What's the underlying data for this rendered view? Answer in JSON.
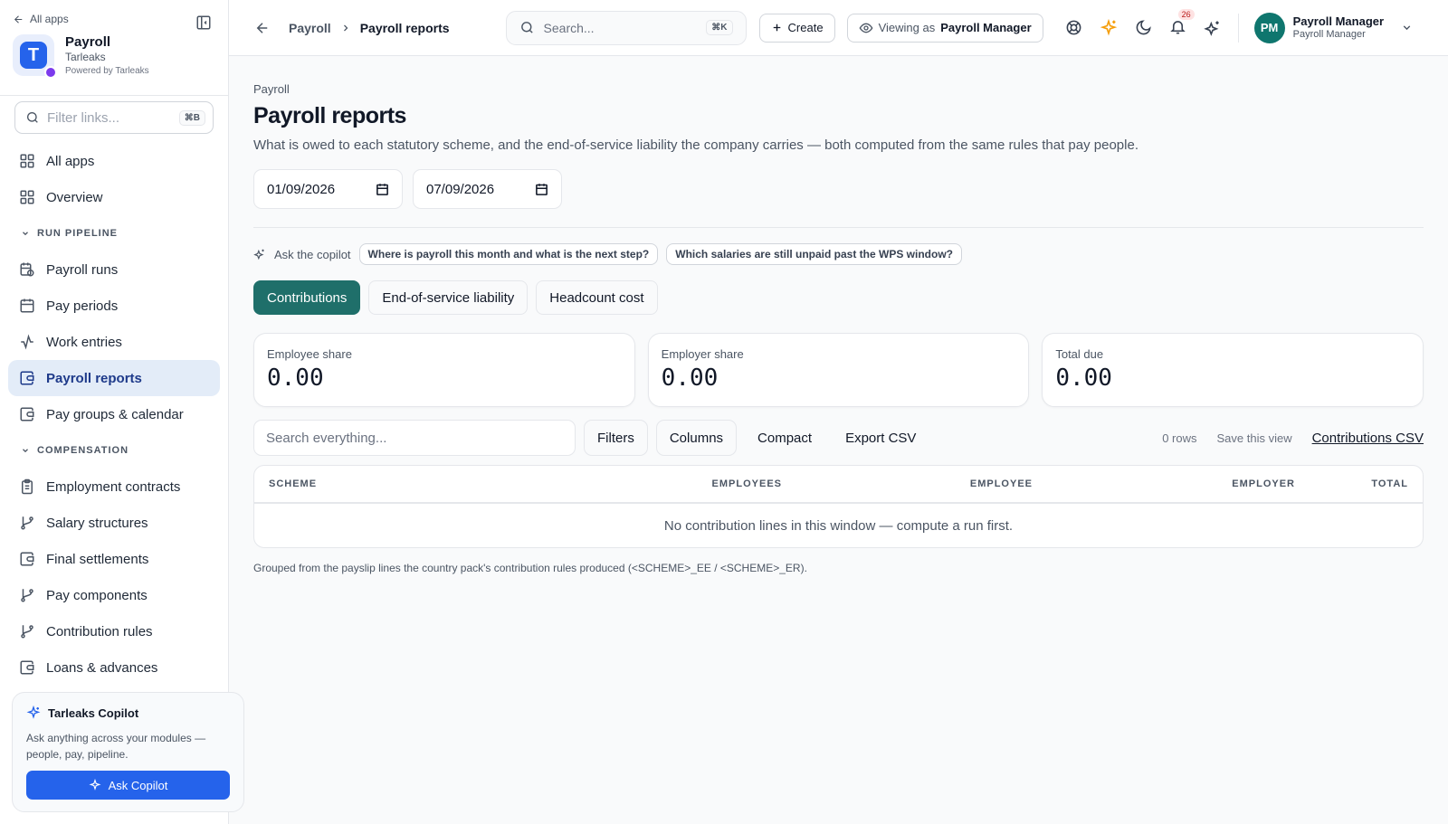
{
  "sidebar": {
    "back_label": "All apps",
    "brand": {
      "letter": "T",
      "name": "Payroll",
      "org": "Tarleaks",
      "powered": "Powered by Tarleaks"
    },
    "filter": {
      "placeholder": "Filter links...",
      "shortcut": "⌘B"
    },
    "top_items": [
      {
        "label": "All apps",
        "icon": "grid-icon"
      },
      {
        "label": "Overview",
        "icon": "grid-icon"
      }
    ],
    "sections": [
      {
        "label": "RUN PIPELINE",
        "items": [
          {
            "label": "Payroll runs",
            "icon": "calendar-clock-icon",
            "active": false
          },
          {
            "label": "Pay periods",
            "icon": "calendar-icon",
            "active": false
          },
          {
            "label": "Work entries",
            "icon": "activity-icon",
            "active": false
          },
          {
            "label": "Payroll reports",
            "icon": "wallet-icon",
            "active": true
          },
          {
            "label": "Pay groups & calendar",
            "icon": "wallet-icon",
            "active": false
          }
        ]
      },
      {
        "label": "COMPENSATION",
        "items": [
          {
            "label": "Employment contracts",
            "icon": "clipboard-icon"
          },
          {
            "label": "Salary structures",
            "icon": "git-branch-icon"
          },
          {
            "label": "Final settlements",
            "icon": "wallet-icon"
          },
          {
            "label": "Pay components",
            "icon": "git-branch-icon"
          },
          {
            "label": "Contribution rules",
            "icon": "git-branch-icon"
          },
          {
            "label": "Loans & advances",
            "icon": "wallet-icon"
          }
        ]
      }
    ],
    "copilot": {
      "title": "Tarleaks Copilot",
      "description": "Ask anything across your modules — people, pay, pipeline.",
      "button": "Ask Copilot"
    }
  },
  "topbar": {
    "breadcrumb": [
      "Payroll",
      "Payroll reports"
    ],
    "search": {
      "placeholder": "Search...",
      "shortcut": "⌘K"
    },
    "create_label": "Create",
    "viewing_label": "Viewing as",
    "viewing_role": "Payroll Manager",
    "notifications_count": "26",
    "user": {
      "initials": "PM",
      "name": "Payroll Manager",
      "role": "Payroll Manager"
    }
  },
  "page": {
    "eyebrow": "Payroll",
    "title": "Payroll reports",
    "description": "What is owed to each statutory scheme, and the end-of-service liability the company carries — both computed from the same rules that pay people.",
    "date_from": "01/09/2026",
    "date_to": "07/09/2026",
    "copilot_label": "Ask the copilot",
    "copilot_prompts": [
      "Where is payroll this month and what is the next step?",
      "Which salaries are still unpaid past the WPS window?"
    ],
    "tabs": [
      {
        "label": "Contributions",
        "active": true
      },
      {
        "label": "End-of-service liability",
        "active": false
      },
      {
        "label": "Headcount cost",
        "active": false
      }
    ],
    "stats": [
      {
        "label": "Employee share",
        "value": "0.00"
      },
      {
        "label": "Employer share",
        "value": "0.00"
      },
      {
        "label": "Total due",
        "value": "0.00"
      }
    ],
    "toolbar": {
      "search_placeholder": "Search everything...",
      "filters": "Filters",
      "columns": "Columns",
      "compact": "Compact",
      "export": "Export CSV",
      "rows": "0 rows",
      "save_view": "Save this view",
      "csv_link": "Contributions CSV"
    },
    "table": {
      "columns": [
        "SCHEME",
        "EMPLOYEES",
        "EMPLOYEE",
        "EMPLOYER",
        "TOTAL"
      ],
      "empty": "No contribution lines in this window — compute a run first."
    },
    "footnote": "Grouped from the payslip lines the country pack's contribution rules produced (<SCHEME>_EE / <SCHEME>_ER)."
  },
  "colors": {
    "accent": "#2563eb",
    "tab_active": "#1f6f6a",
    "nav_active_bg": "#e3ecf8",
    "avatar": "#0f766e",
    "sparkle": "#f59e0b"
  }
}
